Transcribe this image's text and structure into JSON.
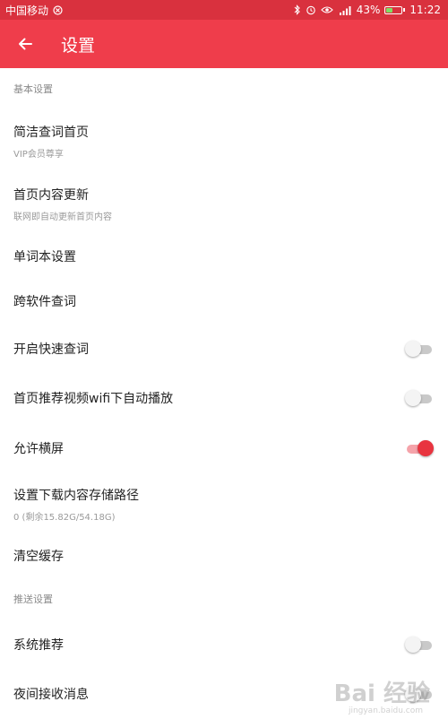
{
  "status_bar": {
    "carrier": "中国移动",
    "battery": "43%",
    "battery_level": 0.43,
    "time": "11:22",
    "icons": [
      "bluetooth-icon",
      "alarm-icon",
      "eye-icon",
      "signal-icon"
    ]
  },
  "app_bar": {
    "title": "设置",
    "back_icon": "arrow-left-icon"
  },
  "sections": {
    "basic": "基本设置",
    "push": "推送设置"
  },
  "items": {
    "simple_home": {
      "label": "简洁查词首页",
      "sub": "VIP会员尊享"
    },
    "home_update": {
      "label": "首页内容更新",
      "sub": "联网即自动更新首页内容"
    },
    "wordbook": {
      "label": "单词本设置"
    },
    "cross_app": {
      "label": "跨软件查词"
    },
    "quick_lookup": {
      "label": "开启快速查词",
      "enabled": false
    },
    "autoplay_video": {
      "label": "首页推荐视频wifi下自动播放",
      "enabled": false
    },
    "landscape": {
      "label": "允许横屏",
      "enabled": true
    },
    "download_path": {
      "label": "设置下载内容存储路径",
      "sub": "0 (剩余15.82G/54.18G)"
    },
    "clear_cache": {
      "label": "清空缓存"
    },
    "system_push": {
      "label": "系统推荐",
      "enabled": false
    },
    "night_push": {
      "label": "夜间接收消息",
      "enabled": false
    }
  },
  "colors": {
    "accent": "#ef3d4b",
    "status_bar": "#d9313e",
    "toggle_on": "#e8343f"
  },
  "watermark": {
    "text": "Bai 经验",
    "sub": "jingyan.baidu.com"
  }
}
